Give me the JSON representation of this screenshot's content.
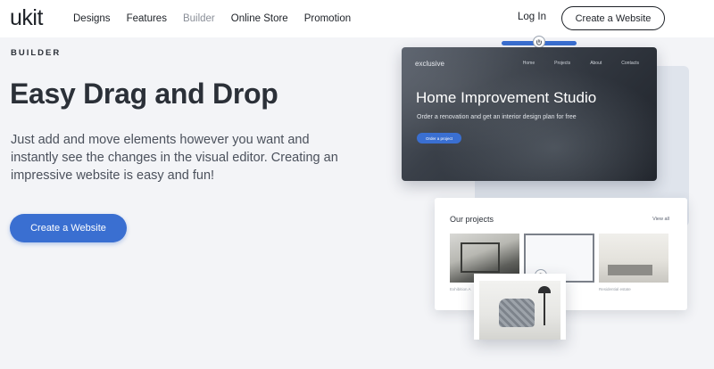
{
  "nav": {
    "logo": "ukit",
    "links": [
      "Designs",
      "Features",
      "Builder",
      "Online Store",
      "Promotion"
    ],
    "active": "Builder",
    "login": "Log In",
    "cta": "Create a Website"
  },
  "hero": {
    "eyebrow": "BUILDER",
    "title": "Easy Drag and Drop",
    "description": "Just add and move elements however you want and instantly see the changes in the visual editor. Creating an impressive website is easy and fun!",
    "cta": "Create a Website"
  },
  "preview": {
    "site_brand": "exclusive",
    "site_menu": [
      "Home",
      "Projects",
      "About",
      "Contacts"
    ],
    "site_title": "Home Improvement Studio",
    "site_subtitle": "Order a renovation and get an interior design plan for free",
    "site_button": "Order a project",
    "projects_title": "Our projects",
    "view_all": "View all",
    "captions": [
      "Exhibition A",
      "Residential estate"
    ]
  },
  "colors": {
    "accent": "#3a6fd1",
    "text": "#2b3038",
    "background": "#f3f4f7"
  }
}
